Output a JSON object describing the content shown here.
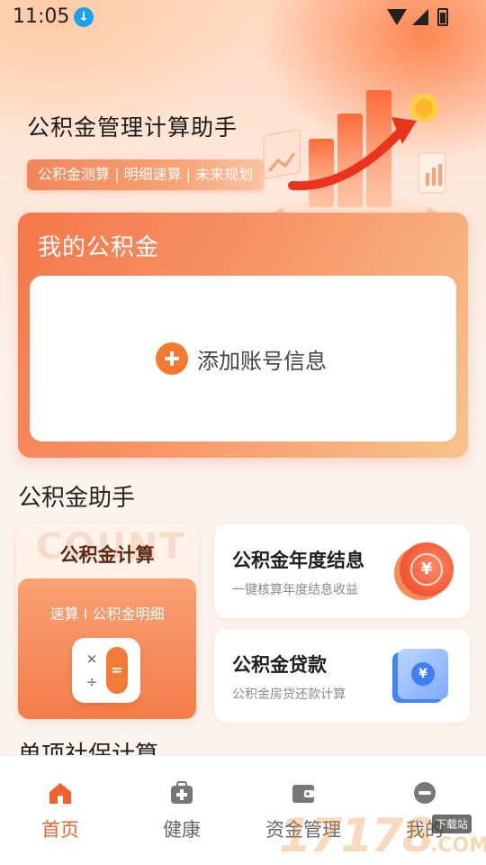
{
  "status_bar": {
    "time": "11:05"
  },
  "header": {
    "title": "公积金管理计算助手",
    "slogan": "公积金测算 | 明细速算 | 未来规划"
  },
  "fund_card": {
    "title": "我的公积金",
    "add_label": "添加账号信息"
  },
  "assistant": {
    "section_title": "公积金助手",
    "calc": {
      "watermark": "COUNT",
      "title": "公积金计算",
      "subtitle": "速算 I 公积金明细",
      "ops": [
        "×",
        "÷"
      ],
      "eq": "="
    },
    "year_settlement": {
      "title": "公积金年度结息",
      "subtitle": "一键核算年度结息收益",
      "icon_symbol": "¥"
    },
    "loan": {
      "title": "公积金贷款",
      "subtitle": "公积金房贷还款计算",
      "icon_symbol": "¥"
    }
  },
  "next_section": {
    "title": "单项社保计算"
  },
  "bottom_nav": {
    "items": [
      {
        "label": "首页",
        "active": true
      },
      {
        "label": "健康",
        "active": false
      },
      {
        "label": "资金管理",
        "active": false
      },
      {
        "label": "我的",
        "active": false
      }
    ]
  },
  "watermark": {
    "number": "17178",
    "tag": "下载站",
    "com": ".COM"
  },
  "colors": {
    "accent": "#f2612b",
    "card_gradient_start": "#f4774a",
    "card_gradient_end": "#f8c38c",
    "loan_blue": "#3f7df0"
  }
}
